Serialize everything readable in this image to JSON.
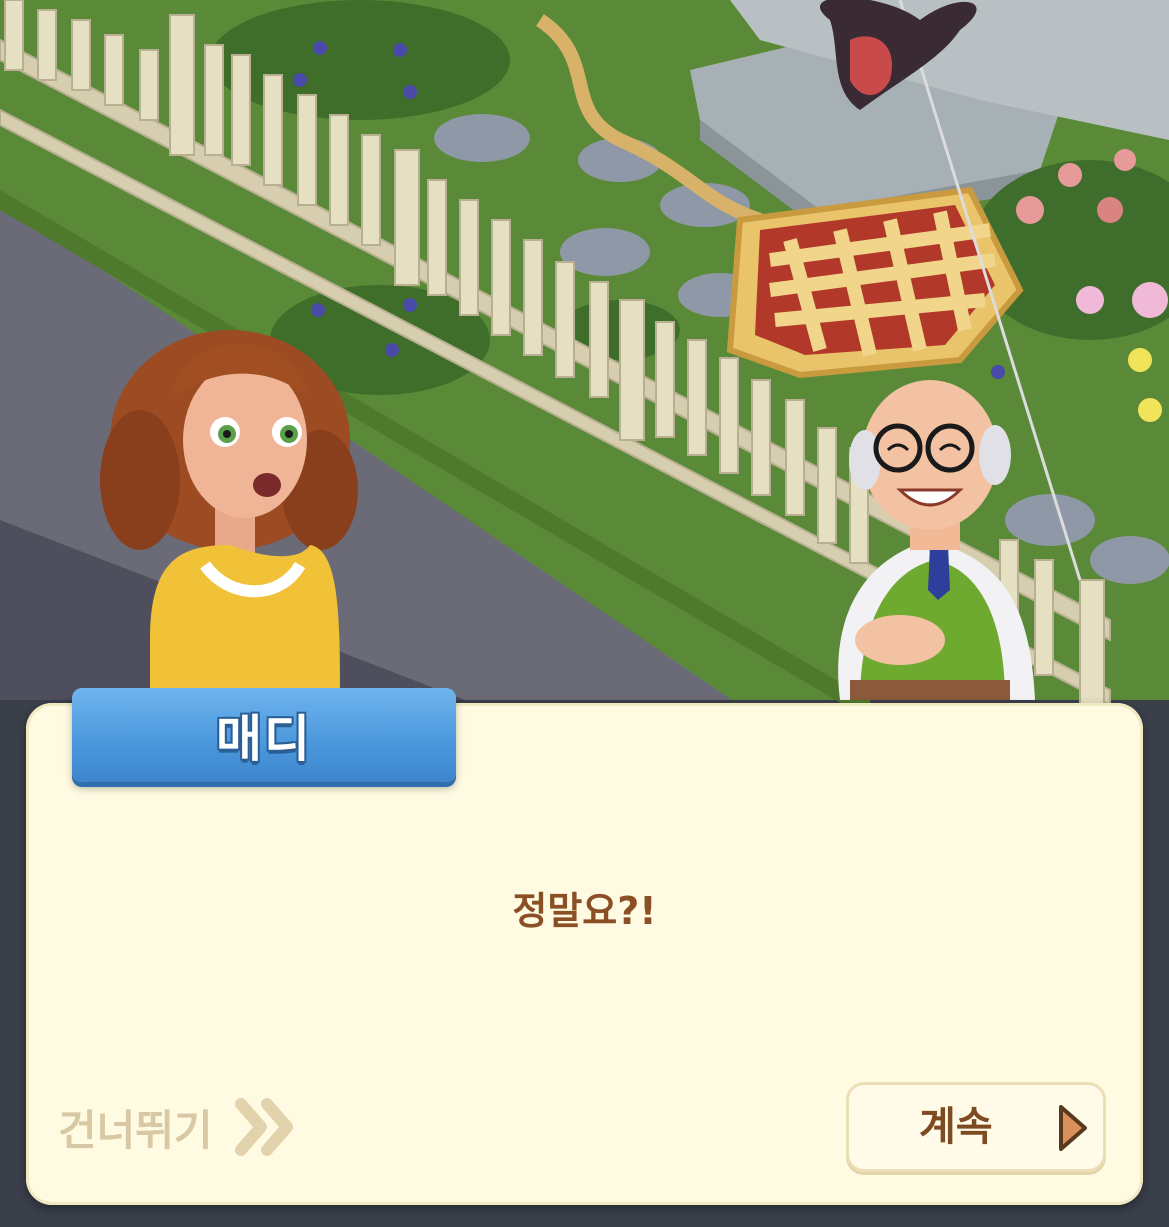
{
  "dialog": {
    "speaker": "매디",
    "line": "정말요?!"
  },
  "controls": {
    "skip_label": "건너뛰기",
    "continue_label": "계속"
  },
  "colors": {
    "dialog_bg": "#fffbe3",
    "nameplate": "#4a97dc",
    "dialog_text": "#8a4f24",
    "skip_text": "#d8c8a3",
    "continue_text": "#7d4a22",
    "continue_arrow": "#d9905a"
  },
  "icons": {
    "skip": "double-chevron-right-icon",
    "continue": "play-arrow-icon"
  }
}
